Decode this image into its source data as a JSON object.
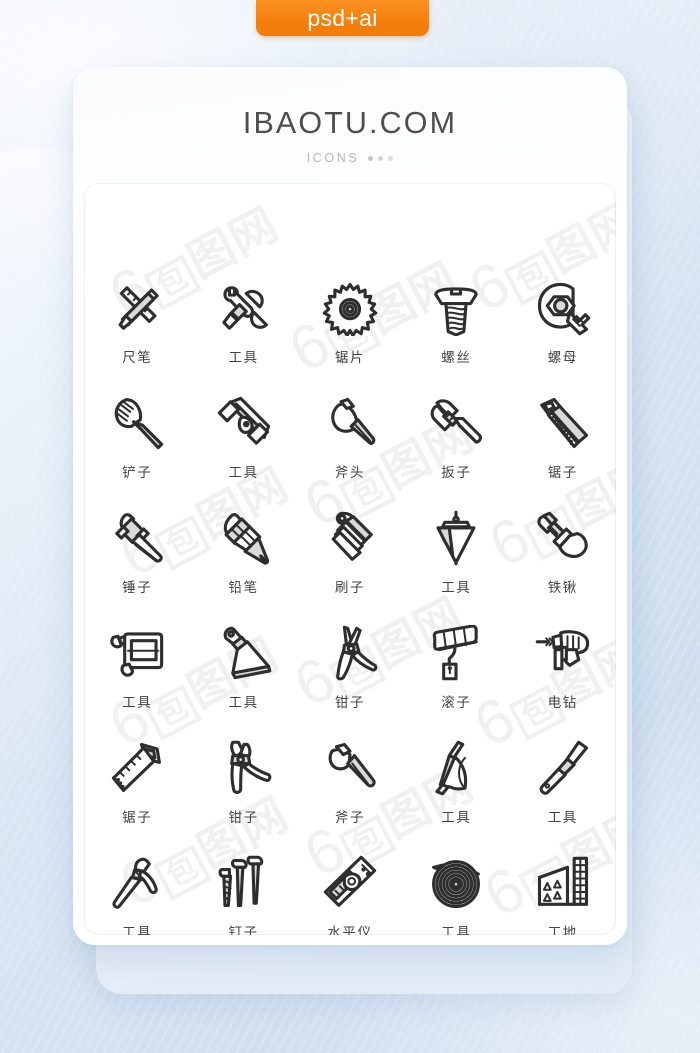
{
  "badge": {
    "label": "psd+ai",
    "color": "#f6800d"
  },
  "card": {
    "brand": "IBAOTU.COM",
    "subtitle": "ICONS",
    "dots": 3
  },
  "watermark": {
    "text": "6包图网",
    "number": "6",
    "boxed": "包",
    "tail": "图网"
  },
  "colors": {
    "background": "#dbe6f3",
    "card": "#ffffff",
    "badge_orange": "#f6800d",
    "brand_text": "#4e4e4e",
    "subtitle_text": "#b6b6b6",
    "icon_stroke": "#2e2e2e",
    "label_text": "#444444"
  },
  "grid": {
    "columns": 5,
    "rows": 6,
    "items": [
      {
        "label": "尺笔",
        "icon": "ruler-pencil-icon"
      },
      {
        "label": "工具",
        "icon": "wrench-screwdriver-icon"
      },
      {
        "label": "锯片",
        "icon": "saw-blade-icon"
      },
      {
        "label": "螺丝",
        "icon": "screw-icon"
      },
      {
        "label": "螺母",
        "icon": "nut-wrench-icon"
      },
      {
        "label": "铲子",
        "icon": "spatula-icon"
      },
      {
        "label": "工具",
        "icon": "sanding-block-icon"
      },
      {
        "label": "斧头",
        "icon": "axe-head-icon"
      },
      {
        "label": "扳子",
        "icon": "pipe-wrench-icon"
      },
      {
        "label": "锯子",
        "icon": "handsaw-icon"
      },
      {
        "label": "锤子",
        "icon": "mallet-icon"
      },
      {
        "label": "铅笔",
        "icon": "pencil-icon"
      },
      {
        "label": "刷子",
        "icon": "paint-brush-icon"
      },
      {
        "label": "工具",
        "icon": "plumb-bob-icon"
      },
      {
        "label": "铁锹",
        "icon": "shovel-icon"
      },
      {
        "label": "工具",
        "icon": "hacksaw-icon"
      },
      {
        "label": "工具",
        "icon": "scraper-icon"
      },
      {
        "label": "钳子",
        "icon": "pliers-icon"
      },
      {
        "label": "滚子",
        "icon": "paint-roller-icon"
      },
      {
        "label": "电钻",
        "icon": "power-drill-icon"
      },
      {
        "label": "锯子",
        "icon": "panel-saw-icon"
      },
      {
        "label": "钳子",
        "icon": "cutting-pliers-icon"
      },
      {
        "label": "斧子",
        "icon": "hatchet-icon"
      },
      {
        "label": "工具",
        "icon": "pruning-saw-icon"
      },
      {
        "label": "工具",
        "icon": "chisel-icon"
      },
      {
        "label": "工具",
        "icon": "pickaxe-icon"
      },
      {
        "label": "钉子",
        "icon": "nails-icon"
      },
      {
        "label": "水平仪",
        "icon": "spirit-level-icon"
      },
      {
        "label": "工具",
        "icon": "wire-coil-icon"
      },
      {
        "label": "工地",
        "icon": "construction-site-icon"
      }
    ]
  }
}
